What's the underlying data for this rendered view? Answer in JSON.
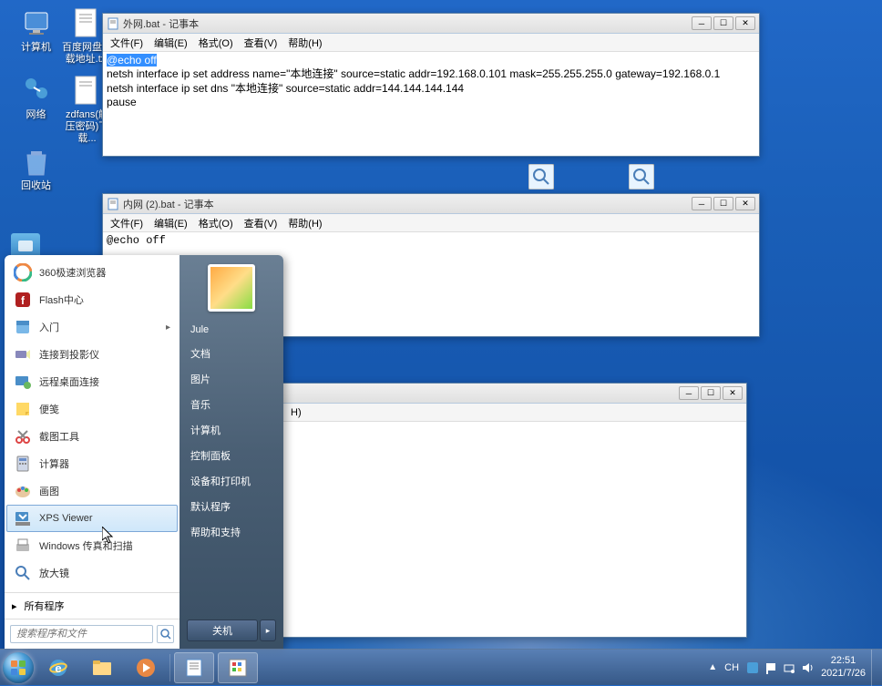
{
  "desktop_icons": {
    "computer": "计算机",
    "baidu": "百度网盘下载地址.txt",
    "network": "网络",
    "zdfans": "zdfans(解压密码)下载...",
    "recycle": "回收站"
  },
  "notepad1": {
    "title": "外网.bat - 记事本",
    "menus": [
      "文件(F)",
      "编辑(E)",
      "格式(O)",
      "查看(V)",
      "帮助(H)"
    ],
    "line1": "@echo off",
    "line2": "netsh interface ip set address name=\"本地连接\" source=static addr=192.168.0.101 mask=255.255.255.0 gateway=192.168.0.1",
    "line3": "netsh interface ip set dns \"本地连接\" source=static addr=144.144.144.144",
    "line4": "pause"
  },
  "notepad2": {
    "title": "内网 (2).bat - 记事本",
    "menus": [
      "文件(F)",
      "编辑(E)",
      "格式(O)",
      "查看(V)",
      "帮助(H)"
    ],
    "content": "@echo off"
  },
  "notepad3": {
    "menus_partial": "H)"
  },
  "start_menu": {
    "user": "Jule",
    "left_items": [
      {
        "label": "360极速浏览器",
        "icon": "browser-icon"
      },
      {
        "label": "Flash中心",
        "icon": "flash-icon"
      },
      {
        "label": "入门",
        "icon": "getting-started-icon",
        "arrow": true
      },
      {
        "label": "连接到投影仪",
        "icon": "projector-icon"
      },
      {
        "label": "远程桌面连接",
        "icon": "rdp-icon"
      },
      {
        "label": "便笺",
        "icon": "sticky-notes-icon"
      },
      {
        "label": "截图工具",
        "icon": "snipping-icon"
      },
      {
        "label": "计算器",
        "icon": "calculator-icon"
      },
      {
        "label": "画图",
        "icon": "paint-icon"
      },
      {
        "label": "XPS Viewer",
        "icon": "xps-icon",
        "hover": true
      },
      {
        "label": "Windows 传真和扫描",
        "icon": "fax-icon"
      },
      {
        "label": "放大镜",
        "icon": "magnifier-icon"
      }
    ],
    "all_programs": "所有程序",
    "search_placeholder": "搜索程序和文件",
    "right_items": [
      "Jule",
      "文档",
      "图片",
      "音乐",
      "计算机",
      "控制面板",
      "设备和打印机",
      "默认程序",
      "帮助和支持"
    ],
    "shutdown": "关机"
  },
  "taskbar": {
    "tray_lang": "CH",
    "time": "22:51",
    "date": "2021/7/26"
  },
  "window_controls": {
    "min": "─",
    "max": "☐",
    "close": "✕"
  }
}
